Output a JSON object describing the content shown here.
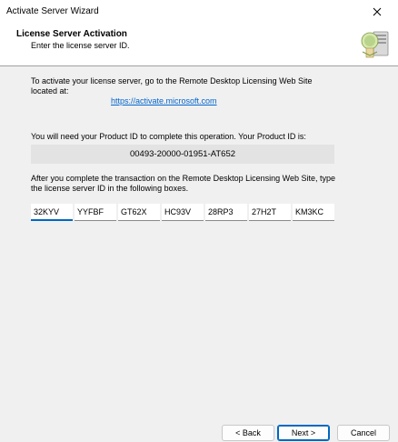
{
  "window": {
    "title": "Activate Server Wizard"
  },
  "header": {
    "title": "License Server Activation",
    "subtitle": "Enter the license server ID."
  },
  "body": {
    "intro": "To activate your license server, go to the Remote Desktop Licensing Web Site located at:",
    "link": "https://activate.microsoft.com",
    "product_id_prompt": "You will need your Product ID to complete this operation. Your Product ID is:",
    "product_id": "00493-20000-01951-AT652",
    "instruction": "After you complete the transaction on the Remote Desktop Licensing Web Site, type the license server ID in the following boxes.",
    "server_id_fields": [
      "32KYV",
      "YYFBF",
      "GT62X",
      "HC93V",
      "28RP3",
      "27H2T",
      "KM3KC"
    ]
  },
  "footer": {
    "back": "< Back",
    "next": "Next >",
    "cancel": "Cancel"
  }
}
